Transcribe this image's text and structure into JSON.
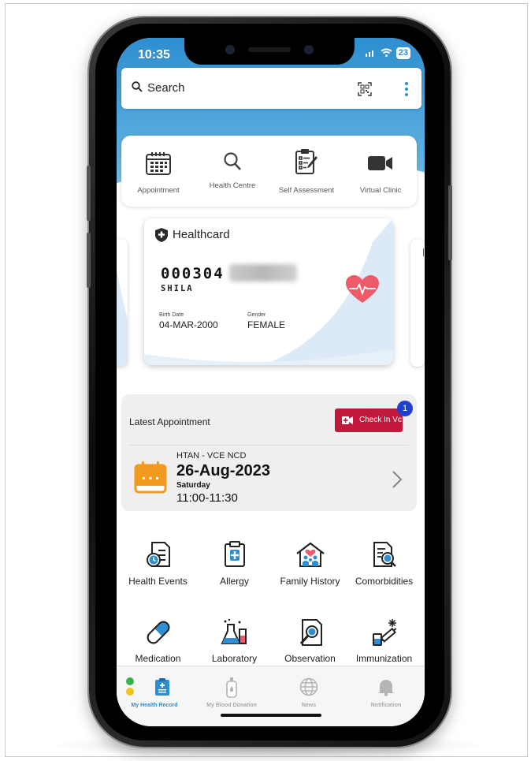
{
  "status_bar": {
    "time": "10:35",
    "battery": "23"
  },
  "search": {
    "placeholder": "Search"
  },
  "quick_actions": [
    {
      "label": "Appointment",
      "icon": "calendar-grid-icon"
    },
    {
      "label": "Health Centre",
      "icon": "search-icon"
    },
    {
      "label": "Self Assessment",
      "icon": "clipboard-edit-icon"
    },
    {
      "label": "Virtual Clinic",
      "icon": "video-camera-icon"
    }
  ],
  "healthcard": {
    "title": "Healthcard",
    "number_prefix": "000304",
    "name": "SHILA",
    "birth_date_label": "Birth Date",
    "birth_date": "04-MAR-2000",
    "gender_label": "Gender",
    "gender": "FEMALE"
  },
  "appointment": {
    "heading": "Latest Appointment",
    "checkin_label": "Check In Vc",
    "badge_count": "1",
    "clinic": "HTAN - VCE NCD",
    "date": "26-Aug-2023",
    "day": "Saturday",
    "time": "11:00-11:30"
  },
  "menu_items": [
    {
      "label": "Health Events",
      "icon": "health-events-icon"
    },
    {
      "label": "Allergy",
      "icon": "allergy-clipboard-icon"
    },
    {
      "label": "Family History",
      "icon": "family-house-icon"
    },
    {
      "label": "Comorbidities",
      "icon": "comorbidities-report-icon"
    },
    {
      "label": "Medication",
      "icon": "pill-capsule-icon"
    },
    {
      "label": "Laboratory",
      "icon": "lab-flask-icon"
    },
    {
      "label": "Observation",
      "icon": "observation-magnifier-icon"
    },
    {
      "label": "Immunization",
      "icon": "vaccine-syringe-icon"
    }
  ],
  "bottom_nav": [
    {
      "label": "My Health Record",
      "active": true
    },
    {
      "label": "My Blood Donation",
      "active": false
    },
    {
      "label": "News",
      "active": false
    },
    {
      "label": "Notification",
      "active": false
    }
  ],
  "colors": {
    "primary": "#2e8ecf",
    "checkin": "#c2183c",
    "calendar": "#f29a1f",
    "heart": "#ef5a6a"
  }
}
